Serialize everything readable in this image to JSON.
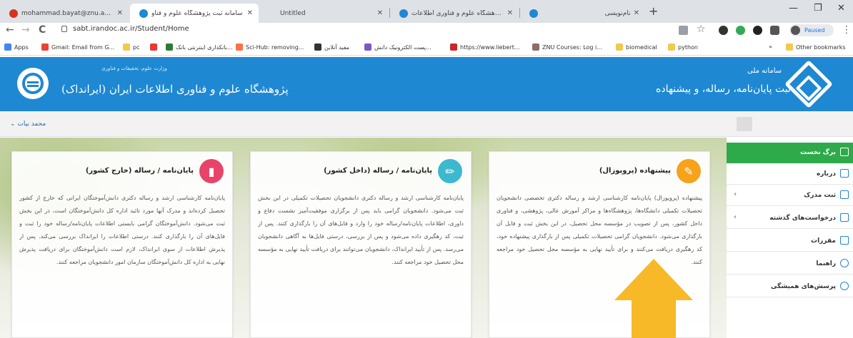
{
  "browser": {
    "tabs": [
      {
        "title": "mohammad.bayat@znu.ac.ir - M",
        "fav_color": "#d93025"
      },
      {
        "title": "سامانه ثبت پژوهشگاه علوم و فناو",
        "fav_color": "#1e88d3"
      },
      {
        "title": "Untitled",
        "fav_color": "#dee1e6"
      },
      {
        "title": "پژوهشگاه علوم و فناوری اطلاعات /",
        "fav_color": "#1e88d3"
      },
      {
        "title": "نام‌نویسی",
        "fav_color": "#1e88d3"
      }
    ],
    "close_glyph": "✕",
    "newtab_glyph": "+",
    "win_min": "—",
    "win_max": "❐",
    "win_close": "✕",
    "back": "←",
    "forward": "→",
    "reload": "C",
    "url": "sabt.irandoc.ac.ir/Student/Home",
    "star": "☆",
    "paused_label": "Paused",
    "menu_dots": "⋮",
    "bookmarks": [
      {
        "label": "Apps",
        "color": "#4285f4"
      },
      {
        "label": "Gmail: Email from G...",
        "color": "#ea4335"
      },
      {
        "label": "pc",
        "color": "#f2c94c"
      },
      {
        "label": "",
        "color": "#e53935"
      },
      {
        "label": "بانکداری اینترنتی بانک...",
        "color": "#2e7d32"
      },
      {
        "label": "Sci-Hub: removing...",
        "color": "#ff7043"
      },
      {
        "label": "مفید آنلاین",
        "color": "#333333"
      },
      {
        "label": "پست الکترونیک دانش...",
        "color": "#7e57c2"
      },
      {
        "label": "https://www.liebert...",
        "color": "#c62828"
      },
      {
        "label": "ZNU Courses: Log i...",
        "color": "#8d6e63"
      },
      {
        "label": "biomedical",
        "color": "#f2c94c"
      },
      {
        "label": "python",
        "color": "#f2c94c"
      }
    ],
    "more_glyph": "»",
    "other_bookmarks": "Other bookmarks"
  },
  "header": {
    "left_small": "وزارت علوم، تحقیقات و فناوری",
    "left_title": "پژوهشگاه علوم و فناوری اطلاعات ایران (ایرانداک)",
    "right_small": "سامانه ملی",
    "right_title": "ثبت پایان‌نامه، رساله، و پیشنهاده"
  },
  "user": {
    "name": "محمد بیات",
    "chevron": "⌄"
  },
  "cards": [
    {
      "title": "پیشنهاده (پروپوزال)",
      "icon": "✎",
      "color": "#f6a21a",
      "text": "پیشنهاده (پروپوزال) پایان‌نامه کارشناسی ارشد و رساله دکتری تخصصی دانشجویان تحصیلات تکمیلی دانشگاه‌ها، پژوهشگاه‌ها و مراکز آموزش عالی، پژوهشی، و فناوری داخل کشور، پس از تصویب در مؤسسه محل تحصیل، در این بخش ثبت و فایل آن بارگذاری می‌شود. دانشجویان گرامی تحصیلات تکمیلی پس از بارگذاری پیشنهاده خود، کد رهگیری دریافت می‌کنند و برای تأیید نهایی به مؤسسه محل تحصیل خود مراجعه کنند."
    },
    {
      "title": "پایان‌نامه / رساله (داخل کشور)",
      "icon": "✏",
      "color": "#3cb8cf",
      "text": "پایان‌نامه کارشناسی ارشد و رساله دکتری دانشجویان تحصیلات تکمیلی در این بخش ثبت می‌شود. دانشجویان گرامی باید پس از برگزاری موفقیت‌آمیز نشست دفاع و داوری، اطلاعات پایان‌نامه/رساله خود را وارد و فایل‌های آن را بارگذاری کنند. پس از ثبت، کد رهگیری داده می‌شود و پس از بررسی، درستی فایل‌ها به آگاهی دانشجویان می‌رسد. پس از تأیید ایرانداک، دانشجویان می‌توانند برای دریافت تأیید نهایی به مؤسسه محل تحصیل خود مراجعه کنند."
    },
    {
      "title": "پایان‌نامه / رساله (خارج کشور)",
      "icon": "▮",
      "color": "#e8436a",
      "text": "پایان‌نامه کارشناسی ارشد و رساله دکتری دانش‌آموختگان ایرانی که خارج از کشور تحصیل کرده‌اند و مدرک آنها مورد تائید اداره کل دانش‌آموختگان است، در این بخش ثبت می‌شود. دانش‌آموختگان گرامی بایستی اطلاعات پایان‌نامه/رساله خود را ثبت و فایل‌های آن را بارگذاری کنند. درستی اطلاعات را ایرانداک بررسی می‌کند. پس از پذیرش اطلاعات از سوی ایرانداک، لازم است دانش‌آموختگان برای دریافت پذیرش نهایی به اداره کل دانش‌آموختگان سازمان امور دانشجویان مراجعه کنند."
    }
  ],
  "sidebar": {
    "items": [
      {
        "label": "برگ نخست",
        "chev": ""
      },
      {
        "label": "درباره",
        "chev": ""
      },
      {
        "label": "ثبت مدرک",
        "chev": "‹"
      },
      {
        "label": "درخواست‌های گذشته",
        "chev": "‹"
      },
      {
        "label": "مقررات",
        "chev": ""
      },
      {
        "label": "راهنما",
        "chev": ""
      },
      {
        "label": "پرسش‌های همیشگی",
        "chev": ""
      }
    ]
  },
  "colors": {
    "header_blue": "#1e88d3",
    "active_green": "#2eaa4a",
    "arrow_yellow": "#f7b928"
  }
}
